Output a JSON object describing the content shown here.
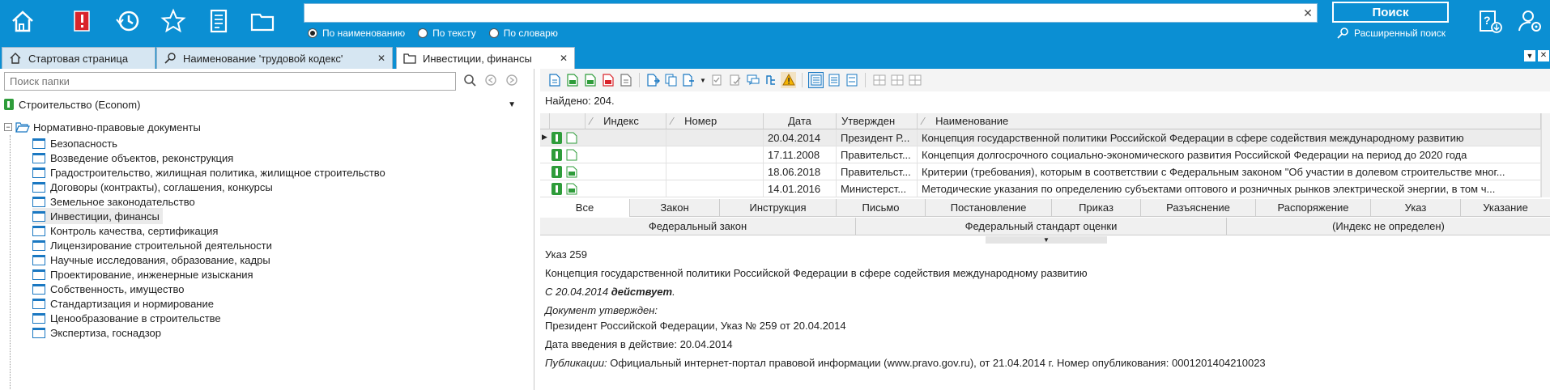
{
  "colors": {
    "accent": "#0b8fd3",
    "icon_red": "#d9242b",
    "icon_green": "#2e9c3a"
  },
  "toolbar": {
    "icons": [
      "home-icon",
      "bookmark-red-icon",
      "history-icon",
      "star-icon",
      "journal-icon",
      "folder-icon"
    ],
    "search_value": "",
    "search_options": [
      "По наименованию",
      "По тексту",
      "По словарю"
    ],
    "selected_option": 0,
    "search_button": "Поиск",
    "advanced_search": "Расширенный поиск",
    "right_icons": [
      "help-download-icon",
      "user-settings-icon"
    ]
  },
  "tabs": [
    {
      "label": "Стартовая страница",
      "icon": "home-icon",
      "closable": false
    },
    {
      "label": "Наименование 'трудовой кодекс'",
      "icon": "search-icon",
      "closable": true
    },
    {
      "label": "Инвестиции, финансы",
      "icon": "folder-icon",
      "closable": true,
      "active": true
    }
  ],
  "left_panel": {
    "folder_search_placeholder": "Поиск папки",
    "base": "Строительство (Econom)",
    "root": "Нормативно-правовые документы",
    "folders": [
      "Безопасность",
      "Возведение объектов, реконструкция",
      "Градостроительство, жилищная политика, жилищное строительство",
      "Договоры (контракты), соглашения, конкурсы",
      "Земельное законодательство",
      "Инвестиции, финансы",
      "Контроль качества, сертификация",
      "Лицензирование строительной деятельности",
      "Научные исследования, образование, кадры",
      "Проектирование, инженерные изыскания",
      "Собственность, имущество",
      "Стандартизация и нормирование",
      "Ценообразование в строительстве",
      "Экспертиза, госнадзор"
    ],
    "selected_folder": 5
  },
  "results": {
    "found": "Найдено: 204.",
    "columns": [
      "Индекс",
      "Номер",
      "Дата",
      "Утвержден",
      "Наименование"
    ],
    "rows": [
      {
        "index": "",
        "number": "",
        "date": "20.04.2014",
        "approved": "Президент Р...",
        "name": "Концепция государственной политики Российской Федерации в сфере содействия международному развитию"
      },
      {
        "index": "",
        "number": "",
        "date": "17.11.2008",
        "approved": "Правительст...",
        "name": "Концепция долгосрочного социально-экономического развития Российской Федерации на период до 2020 года"
      },
      {
        "index": "",
        "number": "",
        "date": "18.06.2018",
        "approved": "Правительст...",
        "name": "Критерии (требования), которым в соответствии с Федеральным законом \"Об участии в долевом строительстве мног..."
      },
      {
        "index": "",
        "number": "",
        "date": "14.01.2016",
        "approved": "Министерст...",
        "name": "Методические указания по определению субъектами оптового и розничных рынков электрической энергии, в том ч..."
      }
    ]
  },
  "type_filters": {
    "row1": [
      "Все",
      "Закон",
      "Инструкция",
      "Письмо",
      "Постановление",
      "Приказ",
      "Разъяснение",
      "Распоряжение",
      "Указ",
      "Указание"
    ],
    "row2": [
      "Федеральный закон",
      "Федеральный стандарт оценки",
      "(Индекс не определен)"
    ],
    "active": 0
  },
  "preview": {
    "title": "Указ 259",
    "name": "Концепция государственной политики Российской Федерации в сфере содействия международному развитию",
    "status_prefix": "С 20.04.2014 ",
    "status": "действует",
    "status_suffix": ".",
    "approved_label": "Документ утвержден:",
    "approved_value": "Президент Российской Федерации, Указ № 259 от 20.04.2014",
    "effective": "Дата введения в действие: 20.04.2014",
    "pub_label": "Публикации:",
    "pub_value": " Официальный интернет-портал правовой информации (www.pravo.gov.ru), от 21.04.2014 г. Номер опубликования: 0001201404210023"
  }
}
